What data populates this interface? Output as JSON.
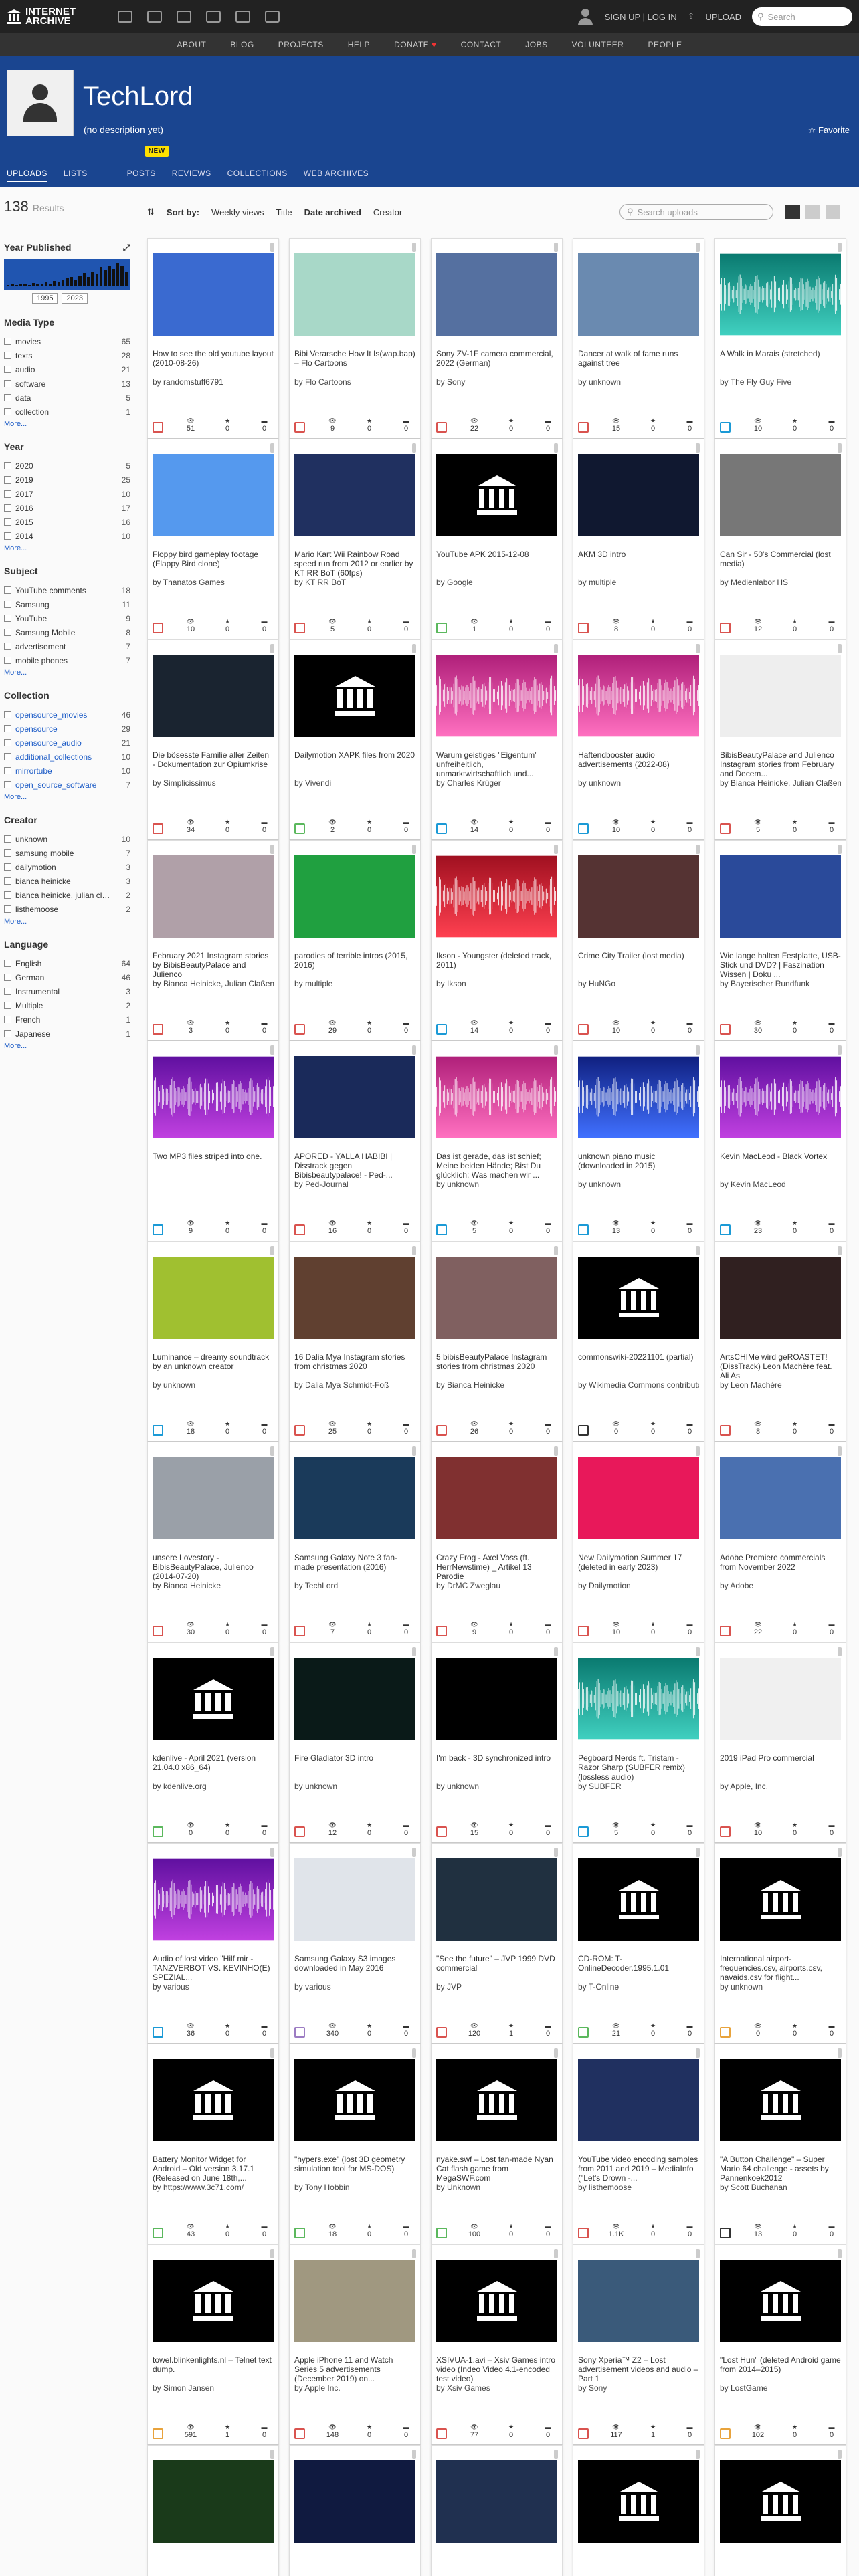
{
  "header": {
    "logo_line1": "INTERNET",
    "logo_line2": "ARCHIVE",
    "signup": "SIGN UP | LOG IN",
    "upload": "UPLOAD",
    "search_placeholder": "Search"
  },
  "nav": [
    "ABOUT",
    "BLOG",
    "PROJECTS",
    "HELP",
    "DONATE",
    "CONTACT",
    "JOBS",
    "VOLUNTEER",
    "PEOPLE"
  ],
  "profile": {
    "name": "TechLord",
    "description": "(no description yet)",
    "favorite": "Favorite",
    "tabs": [
      "UPLOADS",
      "LISTS",
      "POSTS",
      "REVIEWS",
      "COLLECTIONS",
      "WEB ARCHIVES"
    ],
    "new_badge": "NEW"
  },
  "results": {
    "count": "138",
    "label": "Results"
  },
  "sort": {
    "label": "Sort by:",
    "options": [
      "Weekly views",
      "Title",
      "Date archived",
      "Creator"
    ],
    "search_placeholder": "Search uploads"
  },
  "year_published": {
    "title": "Year Published",
    "from": "1995",
    "to": "2023"
  },
  "facets": [
    {
      "title": "Media Type",
      "items": [
        [
          "movies",
          "65"
        ],
        [
          "texts",
          "28"
        ],
        [
          "audio",
          "21"
        ],
        [
          "software",
          "13"
        ],
        [
          "data",
          "5"
        ],
        [
          "collection",
          "1"
        ]
      ]
    },
    {
      "title": "Year",
      "items": [
        [
          "2020",
          "5"
        ],
        [
          "2019",
          "25"
        ],
        [
          "2017",
          "10"
        ],
        [
          "2016",
          "17"
        ],
        [
          "2015",
          "16"
        ],
        [
          "2014",
          "10"
        ]
      ]
    },
    {
      "title": "Subject",
      "items": [
        [
          "YouTube comments",
          "18"
        ],
        [
          "Samsung",
          "11"
        ],
        [
          "YouTube",
          "9"
        ],
        [
          "Samsung Mobile",
          "8"
        ],
        [
          "advertisement",
          "7"
        ],
        [
          "mobile phones",
          "7"
        ]
      ]
    },
    {
      "title": "Collection",
      "link": true,
      "items": [
        [
          "opensource_movies",
          "46"
        ],
        [
          "opensource",
          "29"
        ],
        [
          "opensource_audio",
          "21"
        ],
        [
          "additional_collections",
          "10"
        ],
        [
          "mirrortube",
          "10"
        ],
        [
          "open_source_software",
          "7"
        ]
      ]
    },
    {
      "title": "Creator",
      "items": [
        [
          "unknown",
          "10"
        ],
        [
          "samsung mobile",
          "7"
        ],
        [
          "dailymotion",
          "3"
        ],
        [
          "bianca heinicke",
          "3"
        ],
        [
          "bianca heinicke, julian claßen",
          "2"
        ],
        [
          "listhemoose",
          "2"
        ]
      ]
    },
    {
      "title": "Language",
      "items": [
        [
          "English",
          "64"
        ],
        [
          "German",
          "46"
        ],
        [
          "Instrumental",
          "3"
        ],
        [
          "Multiple",
          "2"
        ],
        [
          "French",
          "1"
        ],
        [
          "Japanese",
          "1"
        ]
      ]
    }
  ],
  "more_label": "More...",
  "items": [
    {
      "title": "How to see the old youtube layout (2010-08-26)",
      "by": "by randomstuff6791",
      "type": "movies",
      "views": "51",
      "favs": "0",
      "reviews": "0",
      "thumb": "#3a6ad0"
    },
    {
      "title": "Bibi Verarsche How It Is(wap.bap) – Flo Cartoons",
      "by": "by Flo Cartoons",
      "type": "movies",
      "views": "9",
      "favs": "0",
      "reviews": "0",
      "thumb": "#a8d8c8"
    },
    {
      "title": "Sony ZV-1F camera commercial, 2022 (German)",
      "by": "by Sony",
      "type": "movies",
      "views": "22",
      "favs": "0",
      "reviews": "0",
      "thumb": "#5570a0"
    },
    {
      "title": "Dancer at walk of fame runs against tree",
      "by": "by unknown",
      "type": "movies",
      "views": "15",
      "favs": "0",
      "reviews": "0",
      "thumb": "#6a8ab0"
    },
    {
      "title": "A Walk in Marais (stretched)",
      "by": "by The Fly Guy Five",
      "type": "audio",
      "views": "10",
      "favs": "0",
      "reviews": "0",
      "thumb": "wave-teal"
    },
    {
      "title": "Floppy bird gameplay footage (Flappy Bird clone)",
      "by": "by Thanatos Games",
      "type": "movies",
      "views": "10",
      "favs": "0",
      "reviews": "0",
      "thumb": "#5599ee"
    },
    {
      "title": "Mario Kart Wii Rainbow Road speed run from 2012 or earlier by KT RR BoT (60fps)",
      "by": "by KT RR BoT",
      "type": "movies",
      "views": "5",
      "favs": "0",
      "reviews": "0",
      "thumb": "#203060"
    },
    {
      "title": "YouTube APK 2015-12-08",
      "by": "by Google",
      "type": "software",
      "views": "1",
      "favs": "0",
      "reviews": "0",
      "thumb": "temple"
    },
    {
      "title": "AKM 3D intro",
      "by": "by multiple",
      "type": "movies",
      "views": "8",
      "favs": "0",
      "reviews": "0",
      "thumb": "#101830"
    },
    {
      "title": "Can Sir - 50's Commercial (lost media)",
      "by": "by Medienlabor HS",
      "type": "movies",
      "views": "12",
      "favs": "0",
      "reviews": "0",
      "thumb": "#777"
    },
    {
      "title": "Die bösesste Familie aller Zeiten - Dokumentation zur Opiumkrise",
      "by": "by Simplicissimus",
      "type": "movies",
      "views": "34",
      "favs": "0",
      "reviews": "0",
      "thumb": "#1a2430"
    },
    {
      "title": "Dailymotion XAPK files from 2020",
      "by": "by Vivendi",
      "type": "software",
      "views": "2",
      "favs": "0",
      "reviews": "0",
      "thumb": "temple"
    },
    {
      "title": "Warum geistiges \"Eigentum\" unfreiheitlich, unmarktwirtschaftlich und...",
      "by": "by Charles Krüger",
      "type": "audio",
      "views": "14",
      "favs": "0",
      "reviews": "0",
      "thumb": "wave-pink"
    },
    {
      "title": "Haftendbooster audio advertisements (2022-08)",
      "by": "by unknown",
      "type": "audio",
      "views": "10",
      "favs": "0",
      "reviews": "0",
      "thumb": "wave-pink"
    },
    {
      "title": "BibisBeautyPalace and Julienco Instagram stories from February and Decem...",
      "by": "by Bianca Heinicke, Julian Claßen",
      "type": "texts",
      "views": "5",
      "favs": "0",
      "reviews": "0",
      "thumb": "#eee"
    },
    {
      "title": "February 2021 Instagram stories by BibisBeautyPalace and Julienco",
      "by": "by Bianca Heinicke, Julian Claßen",
      "type": "texts",
      "views": "3",
      "favs": "0",
      "reviews": "0",
      "thumb": "#b0a0a8"
    },
    {
      "title": "parodies of terrible intros (2015, 2016)",
      "by": "by multiple",
      "type": "movies",
      "views": "29",
      "favs": "0",
      "reviews": "0",
      "thumb": "#20a040"
    },
    {
      "title": "Ikson - Youngster (deleted track, 2011)",
      "by": "by Ikson",
      "type": "audio",
      "views": "14",
      "favs": "0",
      "reviews": "0",
      "thumb": "wave-red"
    },
    {
      "title": "Crime City Trailer (lost media)",
      "by": "by HuNGo",
      "type": "movies",
      "views": "10",
      "favs": "0",
      "reviews": "0",
      "thumb": "#553333"
    },
    {
      "title": "Wie lange halten Festplatte, USB-Stick und DVD? | Faszination Wissen | Doku ...",
      "by": "by Bayerischer Rundfunk",
      "type": "movies",
      "views": "30",
      "favs": "0",
      "reviews": "0",
      "thumb": "#2a4a9a"
    },
    {
      "title": "Two MP3 files striped into one.",
      "by": "",
      "type": "audio",
      "views": "9",
      "favs": "0",
      "reviews": "0",
      "thumb": "wave-purple"
    },
    {
      "title": "APORED - YALLA HABIBI | Disstrack gegen Bibisbeautypalace! - Ped-...",
      "by": "by Ped-Journal",
      "type": "movies",
      "views": "16",
      "favs": "0",
      "reviews": "0",
      "thumb": "#1a2a5a"
    },
    {
      "title": "Das ist gerade, das ist schief; Meine beiden Hände; Bist Du glücklich; Was machen wir ...",
      "by": "by unknown",
      "type": "audio",
      "views": "5",
      "favs": "0",
      "reviews": "0",
      "thumb": "wave-pink"
    },
    {
      "title": "unknown piano music (downloaded in 2015)",
      "by": "by unknown",
      "type": "audio",
      "views": "13",
      "favs": "0",
      "reviews": "0",
      "thumb": "wave-blue"
    },
    {
      "title": "Kevin MacLeod - Black Vortex",
      "by": "by Kevin MacLeod",
      "type": "audio",
      "views": "23",
      "favs": "0",
      "reviews": "0",
      "thumb": "wave-purple"
    },
    {
      "title": "Luminance – dreamy soundtrack by an unknown creator",
      "by": "by unknown",
      "type": "audio",
      "views": "18",
      "favs": "0",
      "reviews": "0",
      "thumb": "#a0c030"
    },
    {
      "title": "16 Dalia Mya Instagram stories from christmas 2020",
      "by": "by Dalia Mya Schmidt-Foß",
      "type": "texts",
      "views": "25",
      "favs": "0",
      "reviews": "0",
      "thumb": "#604030"
    },
    {
      "title": "5 bibisBeautyPalace Instagram stories from christmas 2020",
      "by": "by Bianca Heinicke",
      "type": "texts",
      "views": "26",
      "favs": "0",
      "reviews": "0",
      "thumb": "#806060"
    },
    {
      "title": "commonswiki-20221101 (partial)",
      "by": "by Wikimedia Commons contributors",
      "type": "collection",
      "views": "0",
      "favs": "0",
      "reviews": "0",
      "thumb": "temple"
    },
    {
      "title": "ArtsCHIMe wird geROASTET! (DissTrack) Leon Machère feat. Ali As",
      "by": "by Leon Machère",
      "type": "movies",
      "views": "8",
      "favs": "0",
      "reviews": "0",
      "thumb": "#302020"
    },
    {
      "title": "unsere Lovestory - BibisBeautyPalace, Julienco (2014-07-20)",
      "by": "by Bianca Heinicke",
      "type": "movies",
      "views": "30",
      "favs": "0",
      "reviews": "0",
      "thumb": "#9aa0a8"
    },
    {
      "title": "Samsung Galaxy Note 3 fan-made presentation (2016)",
      "by": "by TechLord",
      "type": "movies",
      "views": "7",
      "favs": "0",
      "reviews": "0",
      "thumb": "#1a3a5a"
    },
    {
      "title": "Crazy Frog - Axel Voss (ft. HerrNewstime) _ Artikel 13 Parodie",
      "by": "by DrMC Zweglau",
      "type": "movies",
      "views": "9",
      "favs": "0",
      "reviews": "0",
      "thumb": "#803030"
    },
    {
      "title": "New Dailymotion Summer 17 (deleted in early 2023)",
      "by": "by Dailymotion",
      "type": "movies",
      "views": "10",
      "favs": "0",
      "reviews": "0",
      "thumb": "#e8185a"
    },
    {
      "title": "Adobe Premiere commercials from November 2022",
      "by": "by Adobe",
      "type": "movies",
      "views": "22",
      "favs": "0",
      "reviews": "0",
      "thumb": "#4a70b0"
    },
    {
      "title": "kdenlive - April 2021 (version 21.04.0 x86_64)",
      "by": "by kdenlive.org",
      "type": "software",
      "views": "0",
      "favs": "0",
      "reviews": "0",
      "thumb": "temple"
    },
    {
      "title": "Fire Gladiator 3D intro",
      "by": "by unknown",
      "type": "movies",
      "views": "12",
      "favs": "0",
      "reviews": "0",
      "thumb": "#0a1a18"
    },
    {
      "title": "I'm back - 3D synchronized intro",
      "by": "by unknown",
      "type": "movies",
      "views": "15",
      "favs": "0",
      "reviews": "0",
      "thumb": "#000"
    },
    {
      "title": "Pegboard Nerds ft. Tristam - Razor Sharp (SUBFER remix) (lossless audio)",
      "by": "by SUBFER",
      "type": "audio",
      "views": "5",
      "favs": "0",
      "reviews": "0",
      "thumb": "wave-teal"
    },
    {
      "title": "2019 iPad Pro commercial",
      "by": "by Apple, Inc.",
      "type": "movies",
      "views": "10",
      "favs": "0",
      "reviews": "0",
      "thumb": "#f0f0f0"
    },
    {
      "title": "Audio of lost video \"Hilf mir - TANZVERBOT VS. KEVINHO(E) SPEZIAL...",
      "by": "by various",
      "type": "audio",
      "views": "36",
      "favs": "0",
      "reviews": "0",
      "thumb": "wave-purple"
    },
    {
      "title": "Samsung Galaxy S3 images downloaded in May 2016",
      "by": "by various",
      "type": "image",
      "views": "340",
      "favs": "0",
      "reviews": "0",
      "thumb": "#e0e4ea"
    },
    {
      "title": "\"See the future\" – JVP 1999 DVD commercial",
      "by": "by JVP",
      "type": "movies",
      "views": "120",
      "favs": "1",
      "reviews": "0",
      "thumb": "#203040"
    },
    {
      "title": "CD-ROM: T-OnlineDecoder.1995.1.01",
      "by": "by T-Online",
      "type": "software",
      "views": "21",
      "favs": "0",
      "reviews": "0",
      "thumb": "temple"
    },
    {
      "title": "International airport-frequencies.csv, airports.csv, navaids.csv for flight...",
      "by": "by unknown",
      "type": "data",
      "views": "0",
      "favs": "0",
      "reviews": "0",
      "thumb": "temple"
    },
    {
      "title": "Battery Monitor Widget for Android – Old version 3.17.1 (Released on June 18th,...",
      "by": "by https://www.3c71.com/",
      "type": "software",
      "views": "43",
      "favs": "0",
      "reviews": "0",
      "thumb": "temple"
    },
    {
      "title": "\"hypers.exe\" (lost 3D geometry simulation tool for MS-DOS)",
      "by": "by Tony Hobbin",
      "type": "software",
      "views": "18",
      "favs": "0",
      "reviews": "0",
      "thumb": "temple"
    },
    {
      "title": "nyake.swf – Lost fan-made Nyan Cat flash game from MegaSWF.com",
      "by": "by Unknown",
      "type": "software",
      "views": "100",
      "favs": "0",
      "reviews": "0",
      "thumb": "temple"
    },
    {
      "title": "YouTube video encoding samples from 2011 and 2019 – MediaInfo (\"Let's Drown -...",
      "by": "by listhemoose",
      "type": "movies",
      "views": "1.1K",
      "favs": "0",
      "reviews": "0",
      "thumb": "#203060"
    },
    {
      "title": "\"A Button Challenge\" – Super Mario 64 challenge - assets by Pannenkoek2012",
      "by": "by Scott Buchanan",
      "type": "collection",
      "views": "13",
      "favs": "0",
      "reviews": "0",
      "thumb": "temple"
    },
    {
      "title": "towel.blinkenlights.nl – Telnet text dump.",
      "by": "by Simon Jansen",
      "type": "data",
      "views": "591",
      "favs": "1",
      "reviews": "0",
      "thumb": "temple"
    },
    {
      "title": "Apple iPhone 11 and Watch Series 5 advertisements (December 2019) on...",
      "by": "by Apple Inc.",
      "type": "movies",
      "views": "148",
      "favs": "0",
      "reviews": "0",
      "thumb": "#a09880"
    },
    {
      "title": "XSIVUA-1.avi – Xsiv Games intro video (Indeo Video 4.1-encoded test video)",
      "by": "by Xsiv Games",
      "type": "movies",
      "views": "77",
      "favs": "0",
      "reviews": "0",
      "thumb": "temple"
    },
    {
      "title": "Sony Xperia™ Z2 – Lost advertisement videos and audio – Part 1",
      "by": "by Sony",
      "type": "movies",
      "views": "117",
      "favs": "1",
      "reviews": "0",
      "thumb": "#3a5a7a"
    },
    {
      "title": "\"Lost Hun\" (deleted Android game from 2014–2015)",
      "by": "by LostGame",
      "type": "data",
      "views": "102",
      "favs": "0",
      "reviews": "0",
      "thumb": "temple"
    },
    {
      "title": "",
      "by": "",
      "type": "movies",
      "views": "",
      "favs": "",
      "reviews": "",
      "thumb": "#1a3a1a"
    },
    {
      "title": "",
      "by": "",
      "type": "movies",
      "views": "",
      "favs": "",
      "reviews": "",
      "thumb": "#101a40"
    },
    {
      "title": "",
      "by": "",
      "type": "movies",
      "views": "",
      "favs": "",
      "reviews": "",
      "thumb": "#203050"
    },
    {
      "title": "",
      "by": "",
      "type": "movies",
      "views": "",
      "favs": "",
      "reviews": "",
      "thumb": "temple"
    },
    {
      "title": "",
      "by": "",
      "type": "movies",
      "views": "",
      "favs": "",
      "reviews": "",
      "thumb": "temple"
    }
  ]
}
